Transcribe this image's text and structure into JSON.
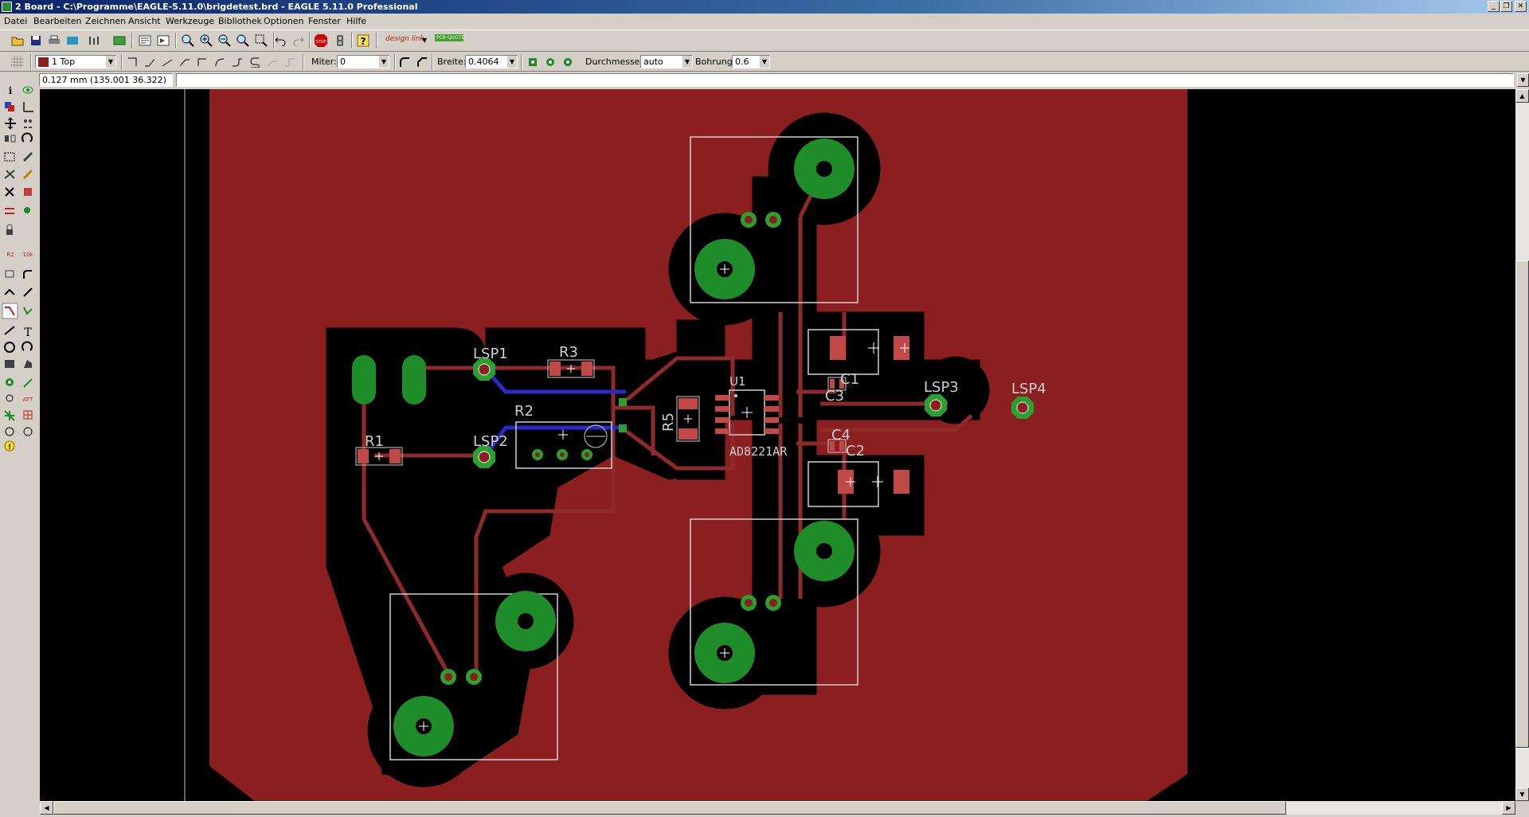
{
  "window": {
    "title": "2 Board - C:\\Programme\\EAGLE-5.11.0\\brigdetest.brd - EAGLE 5.11.0 Professional"
  },
  "menu": [
    "Datei",
    "Bearbeiten",
    "Zeichnen",
    "Ansicht",
    "Werkzeuge",
    "Bibliothek",
    "Optionen",
    "Fenster",
    "Hilfe"
  ],
  "toolbar": {
    "icons": [
      "open-icon",
      "save-icon",
      "print-icon",
      "cam-icon",
      "schematic-icon",
      "library-icon",
      "script-icon",
      "run-icon",
      "zoom-fit-icon",
      "zoom-in-icon",
      "zoom-out-icon",
      "zoom-redraw-icon",
      "zoom-area-icon",
      "undo-icon",
      "redo-icon",
      "stop-icon",
      "go-icon",
      "help-icon"
    ],
    "stop_label": "STOP",
    "designlink_label": "design link",
    "pcbquote_label": "PCB QUOTE"
  },
  "params": {
    "layer": "1 Top",
    "miter_label": "Miter:",
    "miter_value": "0",
    "breite_label": "Breite:",
    "breite_value": "0.4064",
    "durchmesser_label": "Durchmesser:",
    "durchmesser_value": "auto",
    "bohrung_label": "Bohrung:",
    "bohrung_value": "0.6"
  },
  "status": {
    "coordinates": "0.127 mm (135.001 36.322)",
    "command": ""
  },
  "colors": {
    "board": "#8b1f1f",
    "copper_top": "#8f2a2a",
    "pad": "#1e8c28",
    "via_ring": "#2aa030",
    "silkscreen": "#cfcfcf",
    "bottom_trace": "#2a2ac8",
    "smd": "#c04848"
  },
  "board": {
    "labels": {
      "lsp1": "LSP1",
      "lsp2": "LSP2",
      "lsp3": "LSP3",
      "lsp4": "LSP4",
      "r1": "R1",
      "r2": "R2",
      "r3": "R3",
      "r5": "R5",
      "u1": "U1",
      "u1_value": "AD8221AR",
      "c1": "C1",
      "c2": "C2",
      "c3": "C3",
      "c4": "C4"
    }
  }
}
